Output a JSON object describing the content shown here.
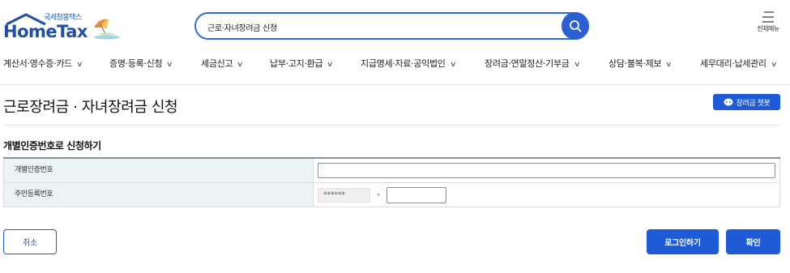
{
  "header": {
    "logo_sub": "국세청홈택스",
    "logo_main": "HomeTax",
    "search_value": "근로·자녀장려금 신청",
    "search_icon": "search-icon",
    "menu_label": "전체메뉴",
    "menu_icon": "hamburger-icon"
  },
  "nav": {
    "items": [
      {
        "label": "계산서·영수증·카드"
      },
      {
        "label": "증명·등록·신청"
      },
      {
        "label": "세금신고"
      },
      {
        "label": "납부·고지·환급"
      },
      {
        "label": "지급명세·자료·공익법인"
      },
      {
        "label": "장려금·연말정산·기부금"
      },
      {
        "label": "상담·불복·제보"
      },
      {
        "label": "세무대리·납세관리"
      }
    ],
    "chevron": "∨"
  },
  "page": {
    "title": "근로장려금 · 자녀장려금 신청",
    "chatbot_label": "장려금 챗봇",
    "chatbot_icon": "chatbot-icon"
  },
  "form": {
    "section_title": "개별인증번호로 신청하기",
    "rows": [
      {
        "label": "개별인증번호",
        "value": ""
      },
      {
        "label": "주민등록번호",
        "front": "******",
        "separator": "-",
        "back": ""
      }
    ]
  },
  "buttons": {
    "cancel": "취소",
    "login": "로그인하기",
    "confirm": "확인"
  },
  "colors": {
    "primary": "#1f5bd6",
    "brand": "#1f4fa8",
    "label_bg": "#eaf4f5"
  }
}
